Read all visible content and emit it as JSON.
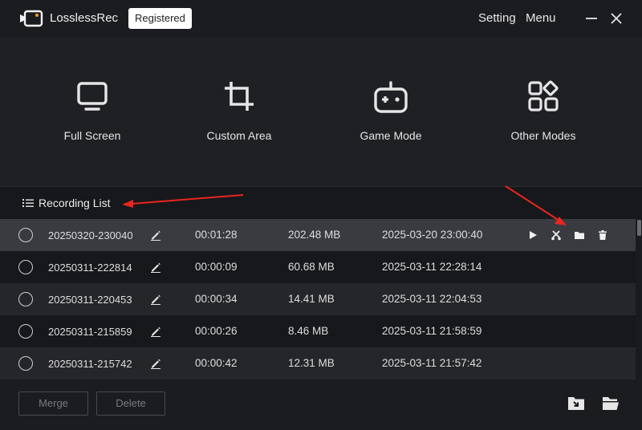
{
  "titlebar": {
    "app_name": "LosslessRec",
    "badge": "Registered",
    "setting": "Setting",
    "menu": "Menu"
  },
  "modes": [
    {
      "label": "Full Screen",
      "icon": "monitor-icon"
    },
    {
      "label": "Custom Area",
      "icon": "crop-icon"
    },
    {
      "label": "Game Mode",
      "icon": "gamepad-icon"
    },
    {
      "label": "Other Modes",
      "icon": "grid-modes-icon"
    }
  ],
  "recording_list": {
    "title": "Recording List",
    "rows": [
      {
        "name": "20250320-230040",
        "duration": "00:01:28",
        "size": "202.48 MB",
        "date": "2025-03-20 23:00:40"
      },
      {
        "name": "20250311-222814",
        "duration": "00:00:09",
        "size": "60.68 MB",
        "date": "2025-03-11 22:28:14"
      },
      {
        "name": "20250311-220453",
        "duration": "00:00:34",
        "size": "14.41 MB",
        "date": "2025-03-11 22:04:53"
      },
      {
        "name": "20250311-215859",
        "duration": "00:00:26",
        "size": "8.46 MB",
        "date": "2025-03-11 21:58:59"
      },
      {
        "name": "20250311-215742",
        "duration": "00:00:42",
        "size": "12.31 MB",
        "date": "2025-03-11 21:57:42"
      }
    ]
  },
  "bottom": {
    "merge": "Merge",
    "delete": "Delete"
  },
  "colors": {
    "background": "#17181c",
    "panel": "#1f2024",
    "selected_row": "#3a3b40",
    "annotation": "#e8261f"
  }
}
